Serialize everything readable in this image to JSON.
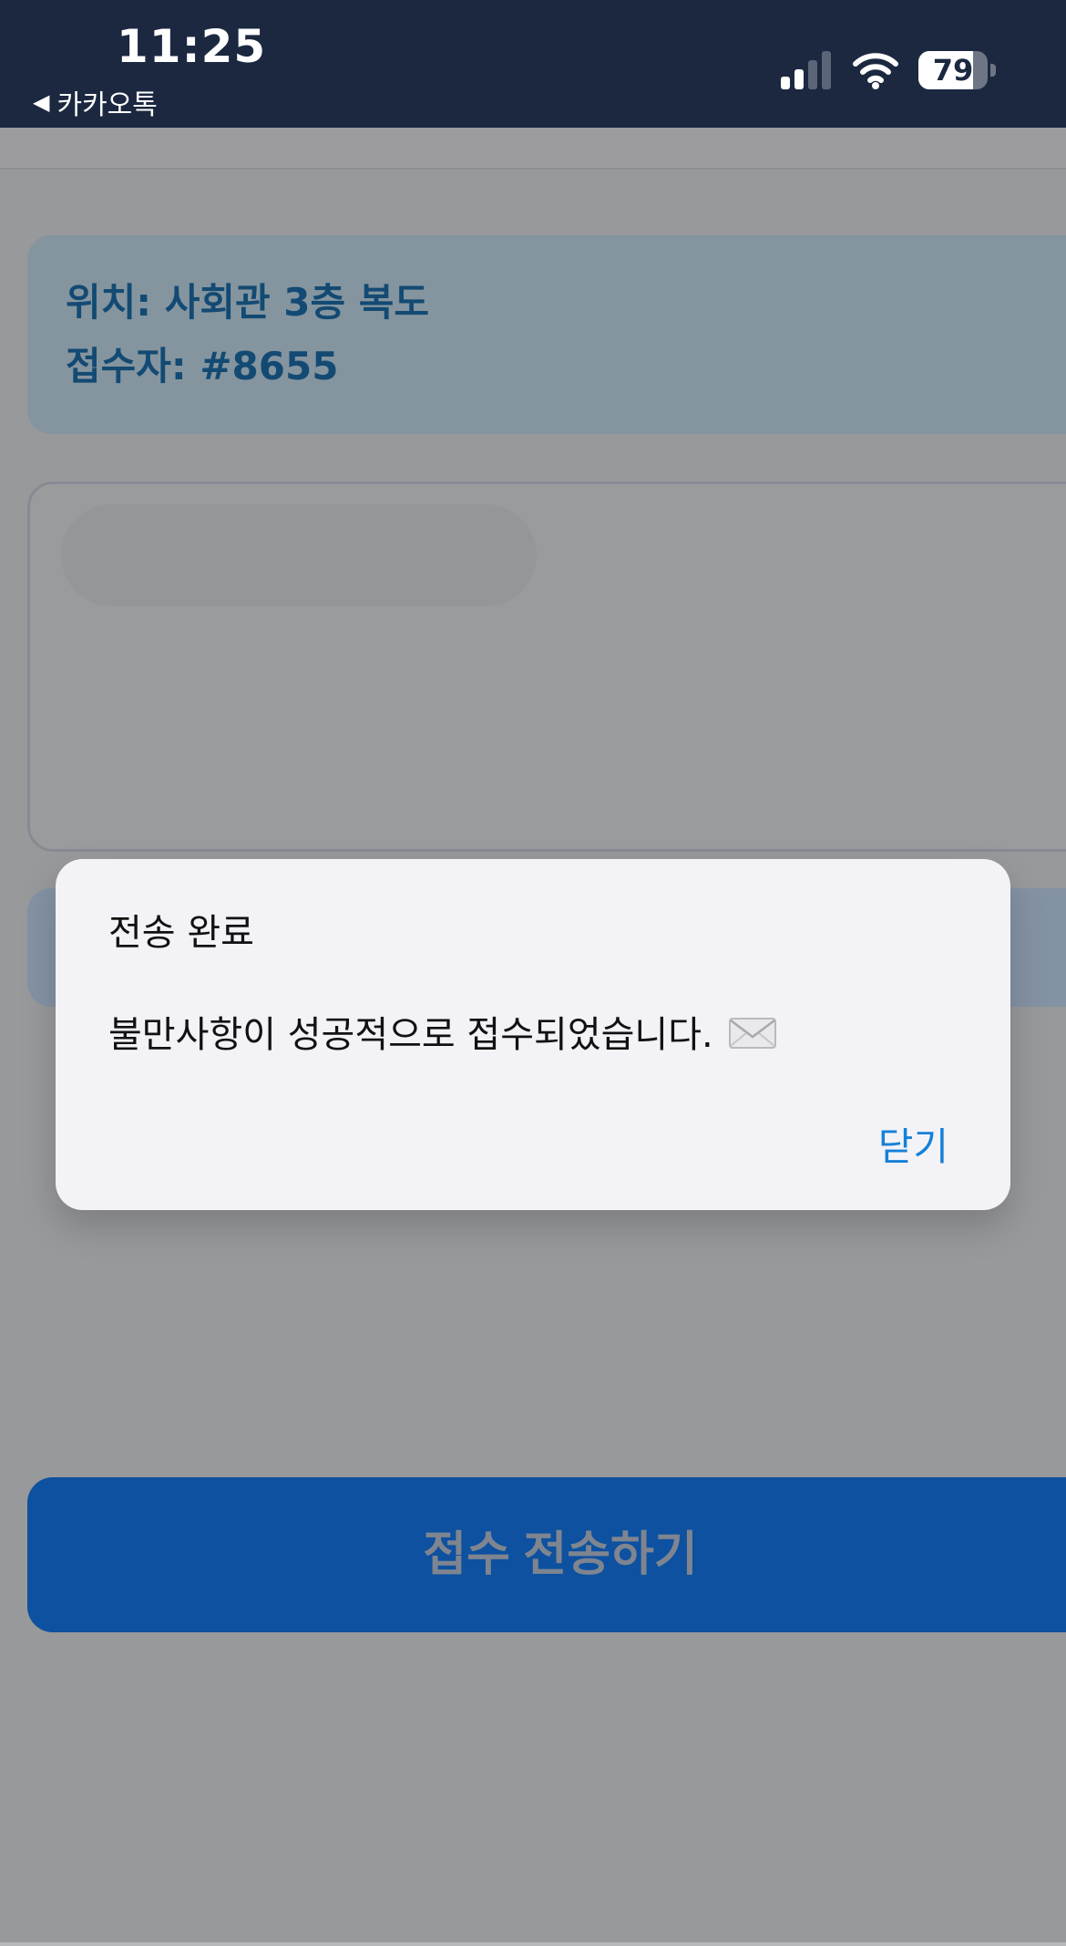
{
  "status_bar": {
    "time": "11:25",
    "back_app_label": "카카오톡",
    "back_icon": "back-triangle-icon",
    "signal_icon": "cellular-signal-icon",
    "wifi_icon": "wifi-icon",
    "battery_level": "79",
    "battery_fraction": 0.79
  },
  "info_card": {
    "location": "위치: 사회관 3층 복도",
    "receiver": "접수자: #8655"
  },
  "form": {
    "submit_label": "접수 전송하기"
  },
  "dialog": {
    "title": "전송 완료",
    "message": "불만사항이 성공적으로 접수되었습니다.",
    "message_icon": "envelope-icon",
    "close_label": "닫기"
  },
  "colors": {
    "status_bar": "#1b2840",
    "accent_blue": "#0d51a0",
    "link_blue": "#1580d8",
    "dialog_bg": "#f2f2f7"
  }
}
